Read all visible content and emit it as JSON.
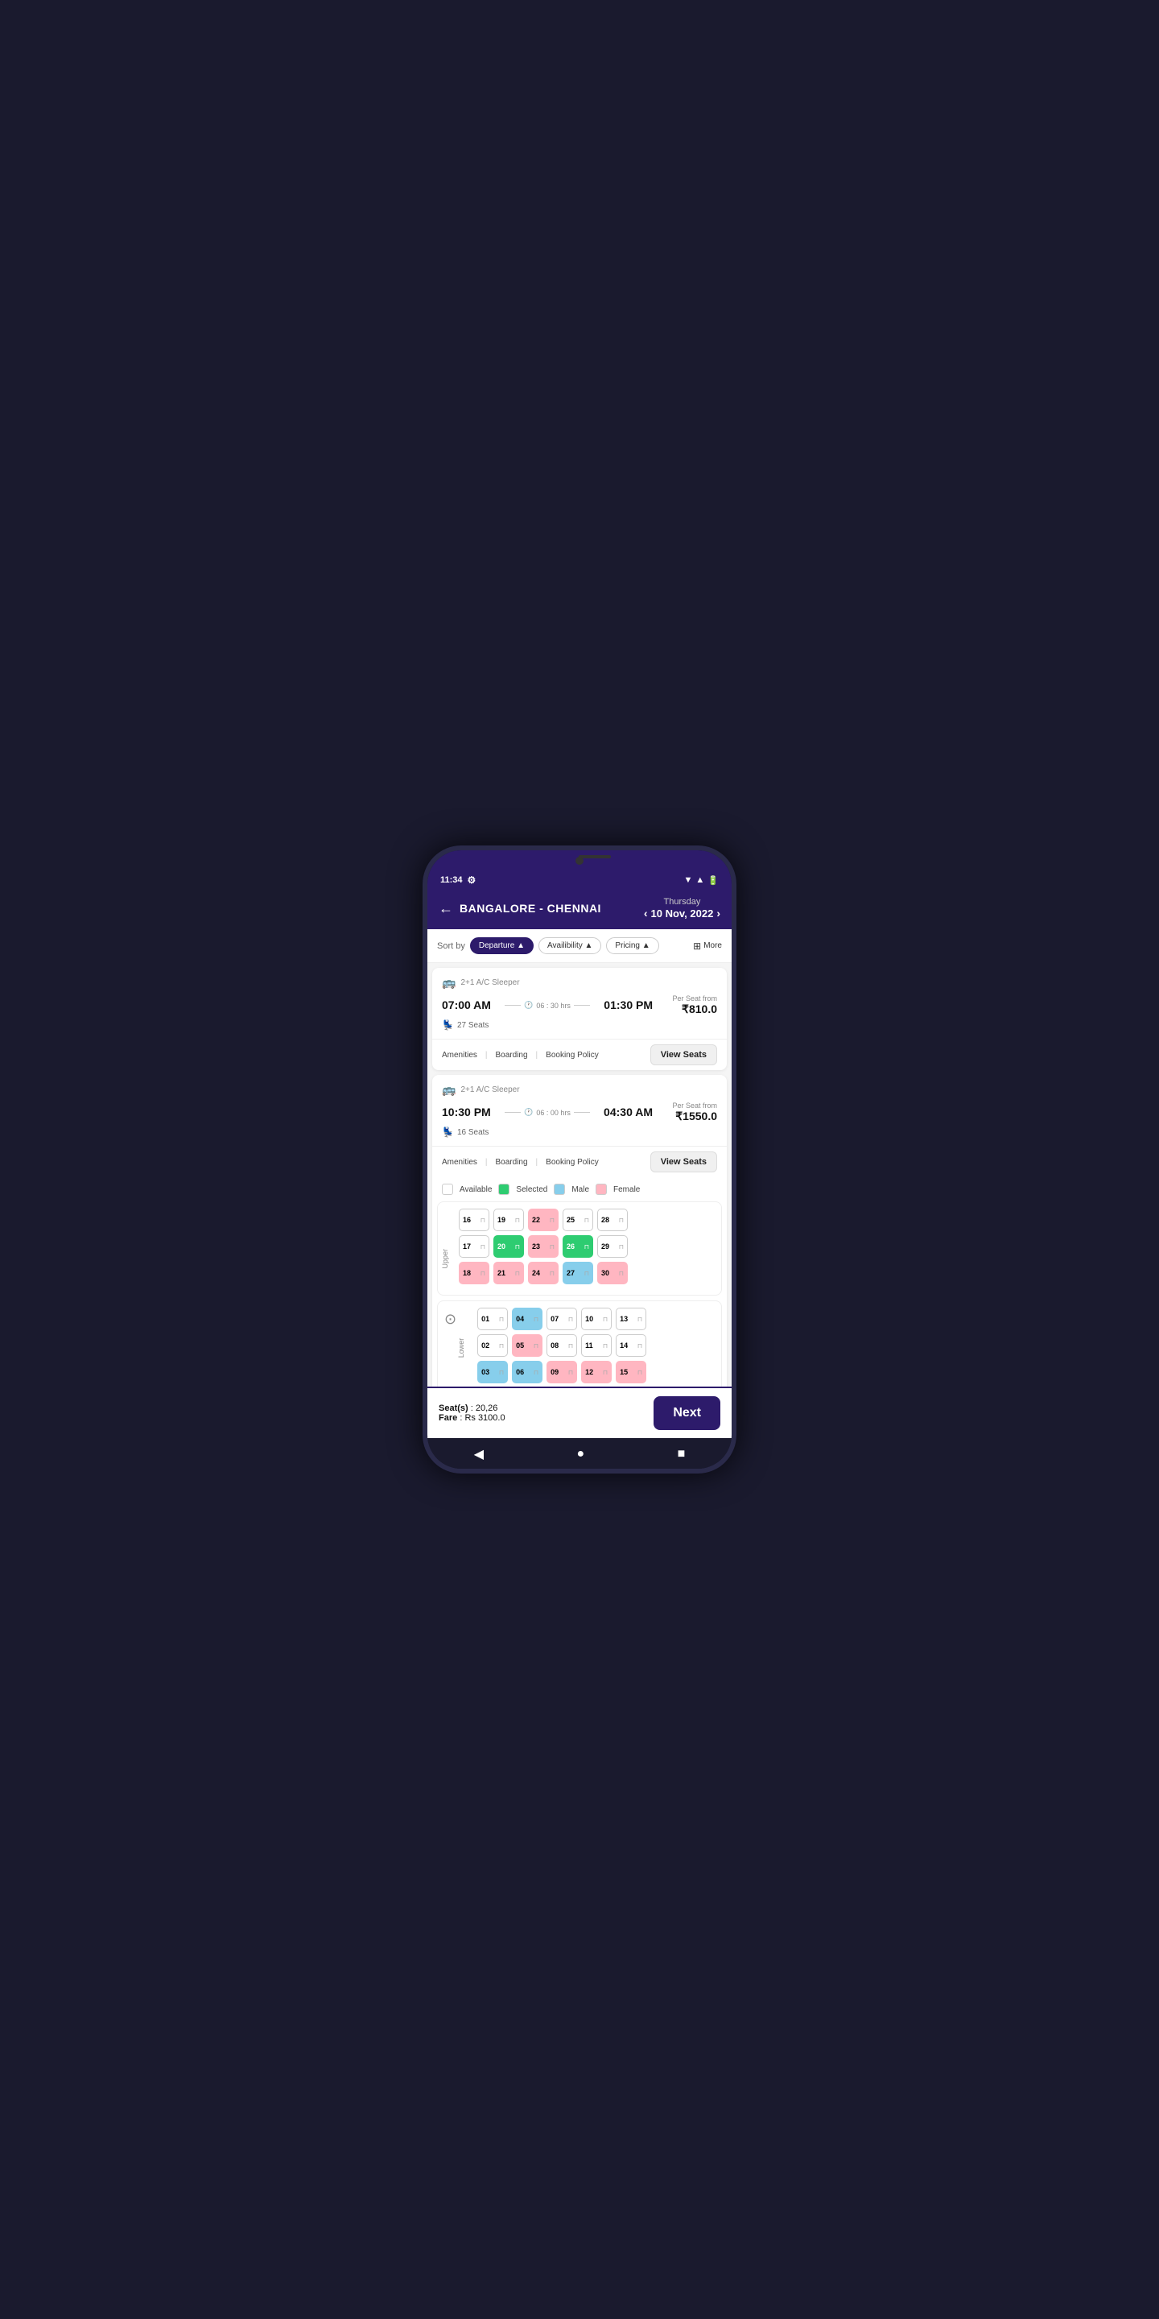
{
  "status": {
    "time": "11:34",
    "settings_icon": "⚙"
  },
  "header": {
    "back_label": "←",
    "route": "BANGALORE - CHENNAI",
    "day": "Thursday",
    "date": "10 Nov, 2022",
    "nav_prev": "‹",
    "nav_next": "›"
  },
  "sort_bar": {
    "label": "Sort by",
    "chips": [
      "Departure ▲",
      "Availibility ▲",
      "Pricing ▲"
    ],
    "more": "More",
    "active_chip": 0
  },
  "buses": [
    {
      "type": "2+1 A/C Sleeper",
      "depart": "07:00 AM",
      "arrive": "01:30 PM",
      "duration": "06 : 30 hrs",
      "seats": "27 Seats",
      "price_label": "Per Seat from",
      "price": "₹810.0",
      "actions": [
        "Amenities",
        "Boarding",
        "Booking Policy"
      ],
      "view_seats": "View Seats"
    },
    {
      "type": "2+1 A/C Sleeper",
      "depart": "10:30 PM",
      "arrive": "04:30 AM",
      "duration": "06 : 00 hrs",
      "seats": "16 Seats",
      "price_label": "Per Seat from",
      "price": "₹1550.0",
      "actions": [
        "Amenities",
        "Boarding",
        "Booking Policy"
      ],
      "view_seats": "View Seats"
    }
  ],
  "legend": {
    "available": "Available",
    "selected": "Selected",
    "male": "Male",
    "female": "Female"
  },
  "upper_deck": {
    "label": "Upper",
    "rows": [
      [
        "16",
        "19",
        "22",
        "25",
        "28"
      ],
      [
        "17",
        "20",
        "23",
        "26",
        "29"
      ],
      [
        "18",
        "21",
        "24",
        "27",
        "30"
      ]
    ],
    "seat_types": {
      "16": "available",
      "19": "available",
      "22": "female",
      "25": "available",
      "28": "available",
      "17": "available",
      "20": "selected-green",
      "23": "female",
      "26": "selected-green",
      "29": "available",
      "18": "female",
      "21": "female",
      "24": "female",
      "27": "male",
      "30": "female"
    }
  },
  "lower_deck": {
    "label": "Lower",
    "rows": [
      [
        "01",
        "04",
        "07",
        "10",
        "13"
      ],
      [
        "02",
        "05",
        "08",
        "11",
        "14"
      ],
      [
        "03",
        "06",
        "09",
        "12",
        "15"
      ]
    ],
    "seat_types": {
      "01": "available",
      "04": "male",
      "07": "available",
      "10": "available",
      "13": "available",
      "02": "available",
      "05": "female",
      "08": "available",
      "11": "available",
      "14": "available",
      "03": "male",
      "06": "male",
      "09": "female",
      "12": "female",
      "15": "female"
    }
  },
  "bottom_bar": {
    "seats_label": "Seat(s)",
    "seats_value": "20,26",
    "fare_label": "Fare",
    "fare_value": "Rs 3100.0",
    "next_button": "Next"
  },
  "nav": {
    "back": "◀",
    "home": "●",
    "square": "■"
  }
}
